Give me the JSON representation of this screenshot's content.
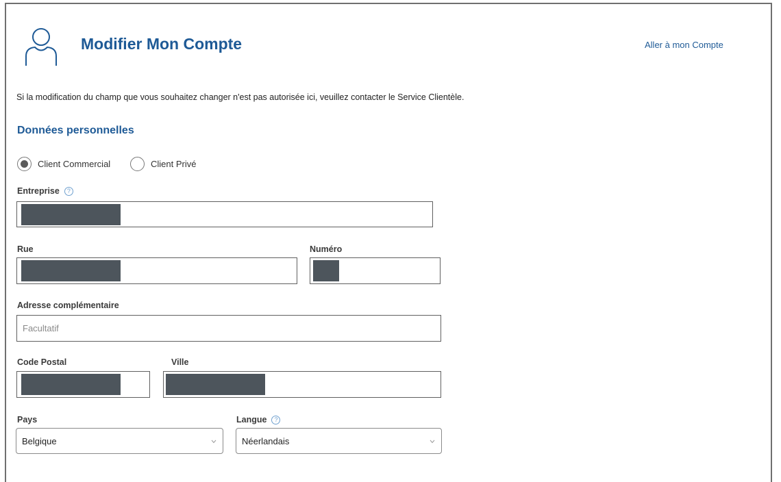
{
  "header": {
    "icon": "user-icon",
    "title": "Modifier Mon Compte",
    "account_link": "Aller à mon Compte"
  },
  "notice": "Si la modification du champ que vous souhaitez changer n'est pas autorisée ici, veuillez contacter le Service Clientèle.",
  "section_title": "Données personnelles",
  "customer_type": {
    "options": [
      "Client Commercial",
      "Client Privé"
    ],
    "selected": "Client Commercial"
  },
  "fields": {
    "company": {
      "label": "Entreprise",
      "value_hidden": true
    },
    "street": {
      "label": "Rue",
      "value_hidden": true
    },
    "number": {
      "label": "Numéro",
      "value_hidden": true
    },
    "extra_address": {
      "label": "Adresse complémentaire",
      "placeholder": "Facultatif"
    },
    "postal_code": {
      "label": "Code Postal",
      "value_hidden": true
    },
    "city": {
      "label": "Ville",
      "value_hidden": true
    },
    "country": {
      "label": "Pays",
      "value": "Belgique"
    },
    "language": {
      "label": "Langue",
      "value": "Néerlandais"
    }
  },
  "help_glyph": "?",
  "colors": {
    "accent": "#1e5a96",
    "redaction": "#4d555c",
    "border": "#5f5f5f"
  }
}
